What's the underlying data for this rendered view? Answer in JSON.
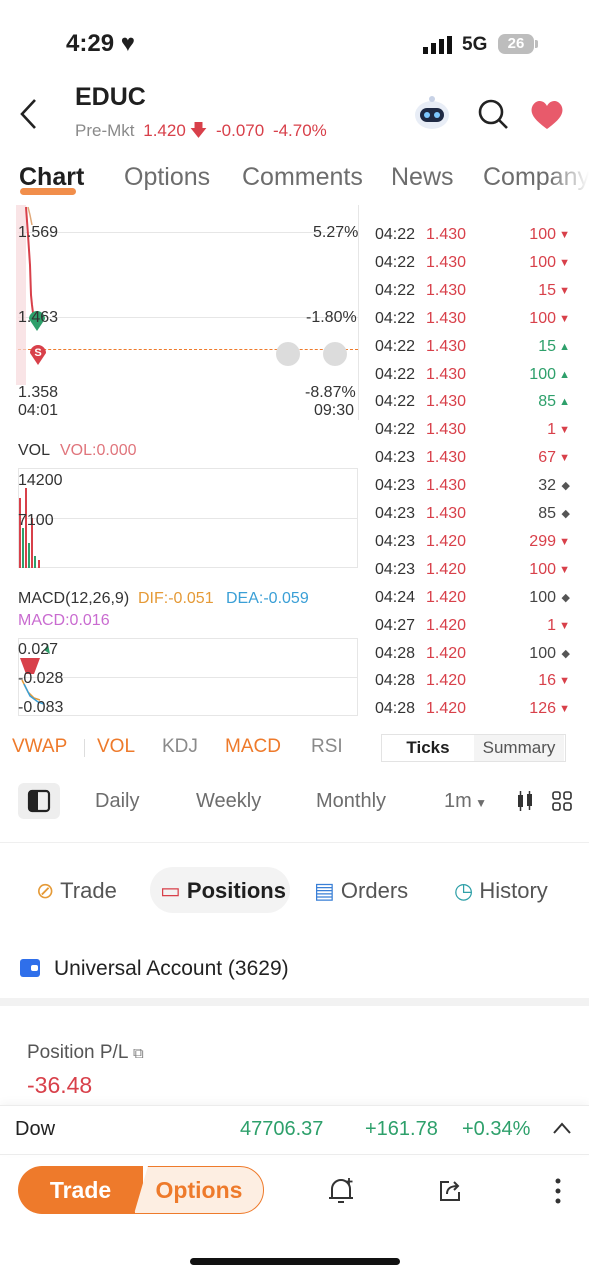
{
  "status_bar": {
    "time": "4:29",
    "network": "5G",
    "battery": "26"
  },
  "header": {
    "ticker": "EDUC",
    "session": "Pre-Mkt",
    "price": "1.420",
    "change": "-0.070",
    "change_pct": "-4.70%"
  },
  "tabs": [
    "Chart",
    "Options",
    "Comments",
    "News",
    "Company"
  ],
  "price_chart": {
    "high_label": "1.569",
    "high_pct": "5.27%",
    "mid_label": "1.463",
    "mid_pct": "-1.80%",
    "low_label": "1.358",
    "low_pct": "-8.87%",
    "time_start": "04:01",
    "time_end": "09:30",
    "sell_marker": "S"
  },
  "vol": {
    "title": "VOL",
    "value_label": "VOL:0.000",
    "tick_high": "14200",
    "tick_mid": "7100"
  },
  "macd": {
    "title": "MACD(12,26,9)",
    "dif": "DIF:-0.051",
    "dea": "DEA:-0.059",
    "macd": "MACD:0.016",
    "tick_high": "0.027",
    "tick_mid": "-0.028",
    "tick_low": "-0.083"
  },
  "ticks": [
    {
      "time": "04:22",
      "price": "1.430",
      "vol": "100",
      "dir": "down"
    },
    {
      "time": "04:22",
      "price": "1.430",
      "vol": "100",
      "dir": "down"
    },
    {
      "time": "04:22",
      "price": "1.430",
      "vol": "15",
      "dir": "down"
    },
    {
      "time": "04:22",
      "price": "1.430",
      "vol": "100",
      "dir": "down"
    },
    {
      "time": "04:22",
      "price": "1.430",
      "vol": "15",
      "dir": "up"
    },
    {
      "time": "04:22",
      "price": "1.430",
      "vol": "100",
      "dir": "up"
    },
    {
      "time": "04:22",
      "price": "1.430",
      "vol": "85",
      "dir": "up"
    },
    {
      "time": "04:22",
      "price": "1.430",
      "vol": "1",
      "dir": "down"
    },
    {
      "time": "04:23",
      "price": "1.430",
      "vol": "67",
      "dir": "down"
    },
    {
      "time": "04:23",
      "price": "1.430",
      "vol": "32",
      "dir": "neutral"
    },
    {
      "time": "04:23",
      "price": "1.430",
      "vol": "85",
      "dir": "neutral"
    },
    {
      "time": "04:23",
      "price": "1.420",
      "vol": "299",
      "dir": "down"
    },
    {
      "time": "04:23",
      "price": "1.420",
      "vol": "100",
      "dir": "down"
    },
    {
      "time": "04:24",
      "price": "1.420",
      "vol": "100",
      "dir": "neutral"
    },
    {
      "time": "04:27",
      "price": "1.420",
      "vol": "1",
      "dir": "down"
    },
    {
      "time": "04:28",
      "price": "1.420",
      "vol": "100",
      "dir": "neutral"
    },
    {
      "time": "04:28",
      "price": "1.420",
      "vol": "16",
      "dir": "down"
    },
    {
      "time": "04:28",
      "price": "1.420",
      "vol": "126",
      "dir": "down"
    }
  ],
  "indicators": [
    "VWAP",
    "VOL",
    "KDJ",
    "MACD",
    "RSI"
  ],
  "ticks_toggle": {
    "ticks": "Ticks",
    "summary": "Summary"
  },
  "periods": [
    "Daily",
    "Weekly",
    "Monthly",
    "1m"
  ],
  "trade_tabs": [
    "Trade",
    "Positions",
    "Orders",
    "History"
  ],
  "account": {
    "name": "Universal Account (3629)"
  },
  "position": {
    "label": "Position P/L",
    "value": "-36.48"
  },
  "index_bar": {
    "name": "Dow",
    "value": "47706.37",
    "change": "+161.78",
    "pct": "+0.34%"
  },
  "bottom": {
    "trade": "Trade",
    "options": "Options"
  },
  "colors": {
    "up": "#2ea06b",
    "down": "#d8404a",
    "accent": "#ee7a2b"
  }
}
